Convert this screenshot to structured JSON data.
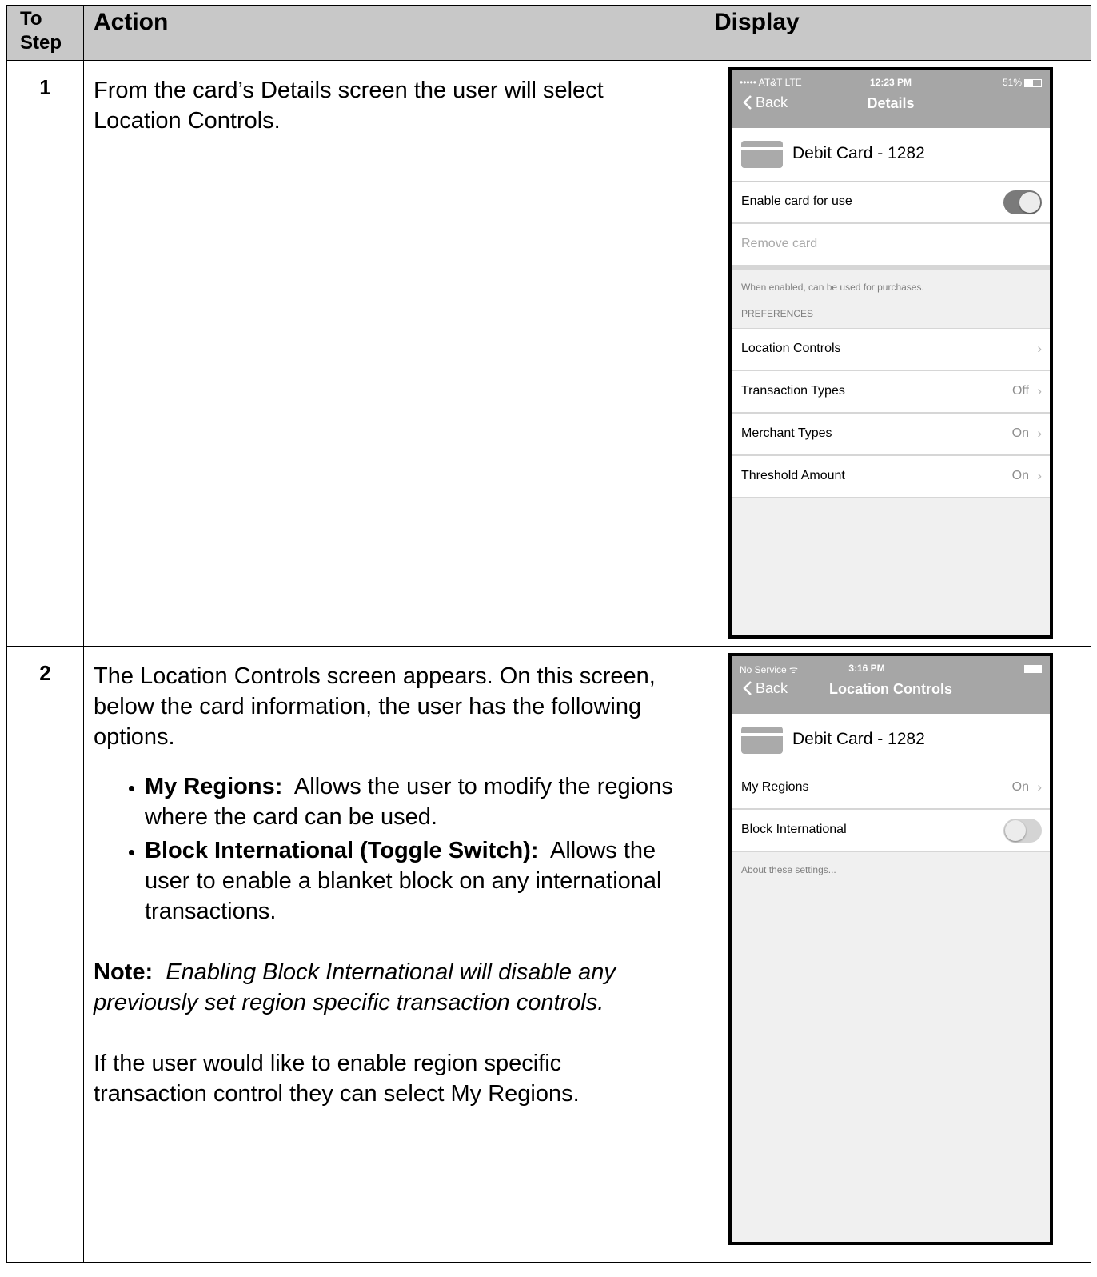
{
  "table": {
    "header": {
      "step": "To Step",
      "action": "Action",
      "display": "Display"
    },
    "rows": [
      {
        "step": "1",
        "action_text": "From the card’s Details screen the user will select Location Controls."
      },
      {
        "step": "2",
        "intro": "The Location Controls screen appears.  On this screen, below the card information, the user has the following options.",
        "options": [
          {
            "term": "My Regions:",
            "desc": "  Allows the user to modify the regions where the card can be used."
          },
          {
            "term": "Block International (Toggle Switch):",
            "desc": "  Allows the user to enable a blanket block on any international transactions."
          }
        ],
        "note_label": "Note:",
        "note_text": "  Enabling Block International will disable any previously set region specific transaction controls.",
        "closing": "If the user would like to enable region specific transaction control they can select My Regions."
      }
    ]
  },
  "phone1": {
    "status": {
      "carrier": "••••• AT&T  LTE",
      "time": "12:23 PM",
      "battery": "51%",
      "battery_level": 0.51
    },
    "back_label": "Back",
    "title": "Details",
    "card_label": "Debit Card - 1282",
    "enable_label": "Enable card for use",
    "enable_on": true,
    "remove_label": "Remove card",
    "footnote": "When enabled, can be used for purchases.",
    "section": "PREFERENCES",
    "items": [
      {
        "label": "Location Controls",
        "value": ""
      },
      {
        "label": "Transaction Types",
        "value": "Off"
      },
      {
        "label": "Merchant Types",
        "value": "On"
      },
      {
        "label": "Threshold Amount",
        "value": "On"
      }
    ]
  },
  "phone2": {
    "status": {
      "carrier": "No Service ᯤ",
      "time": "3:16 PM",
      "battery_level": 1.0
    },
    "back_label": "Back",
    "title": "Location Controls",
    "card_label": "Debit Card - 1282",
    "regions_label": "My Regions",
    "regions_value": "On",
    "block_label": "Block International",
    "block_on": false,
    "footnote": "About these settings..."
  },
  "colors": {
    "header_bg": "#c8c8c8",
    "nav_bg": "#a6a6a6",
    "toggle_on": "#7a7a7a",
    "toggle_off": "#d4d4d4"
  }
}
